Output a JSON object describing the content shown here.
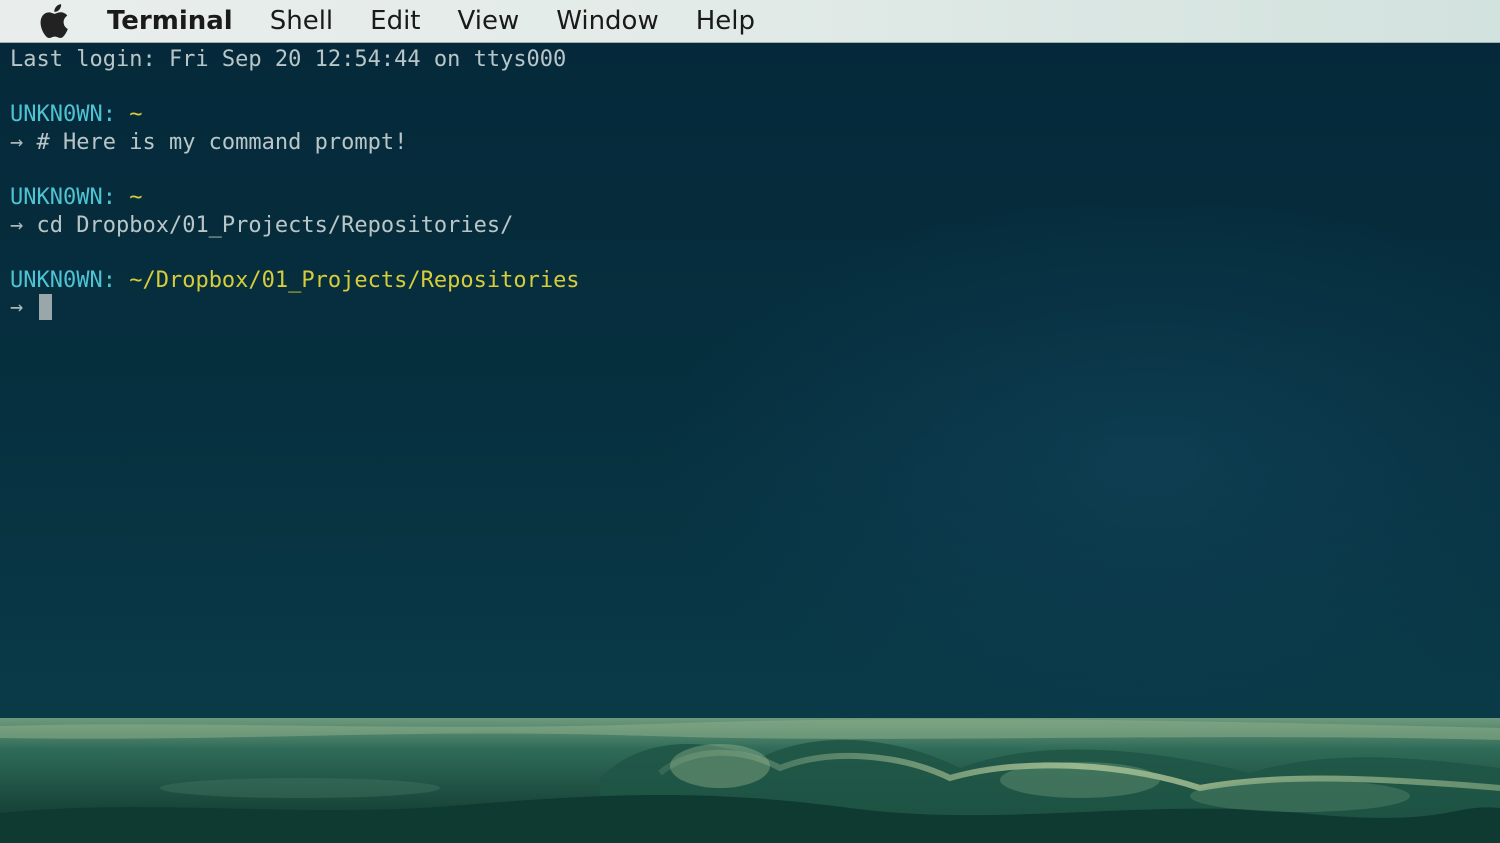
{
  "menubar": {
    "apple_icon": "apple-logo-icon",
    "items": [
      {
        "label": "Terminal",
        "bold": true
      },
      {
        "label": "Shell"
      },
      {
        "label": "Edit"
      },
      {
        "label": "View"
      },
      {
        "label": "Window"
      },
      {
        "label": "Help"
      }
    ]
  },
  "terminal": {
    "last_login": "Last login: Fri Sep 20 12:54:44 on ttys000",
    "blocks": [
      {
        "user": "UNKN0WN:",
        "path": "~",
        "arrow": "→",
        "command": "# Here is my command prompt!"
      },
      {
        "user": "UNKN0WN:",
        "path": "~",
        "arrow": "→",
        "command": "cd Dropbox/01_Projects/Repositories/"
      },
      {
        "user": "UNKN0WN:",
        "path": "~/Dropbox/01_Projects/Repositories",
        "arrow": "→",
        "command": ""
      }
    ]
  },
  "colors": {
    "terminal_bg": "#05293a",
    "user": "#4fc3d4",
    "path": "#d7cc3a",
    "text": "#b9c6c8",
    "cursor": "#9aa7aa",
    "wallpaper": "#1c4f43"
  }
}
